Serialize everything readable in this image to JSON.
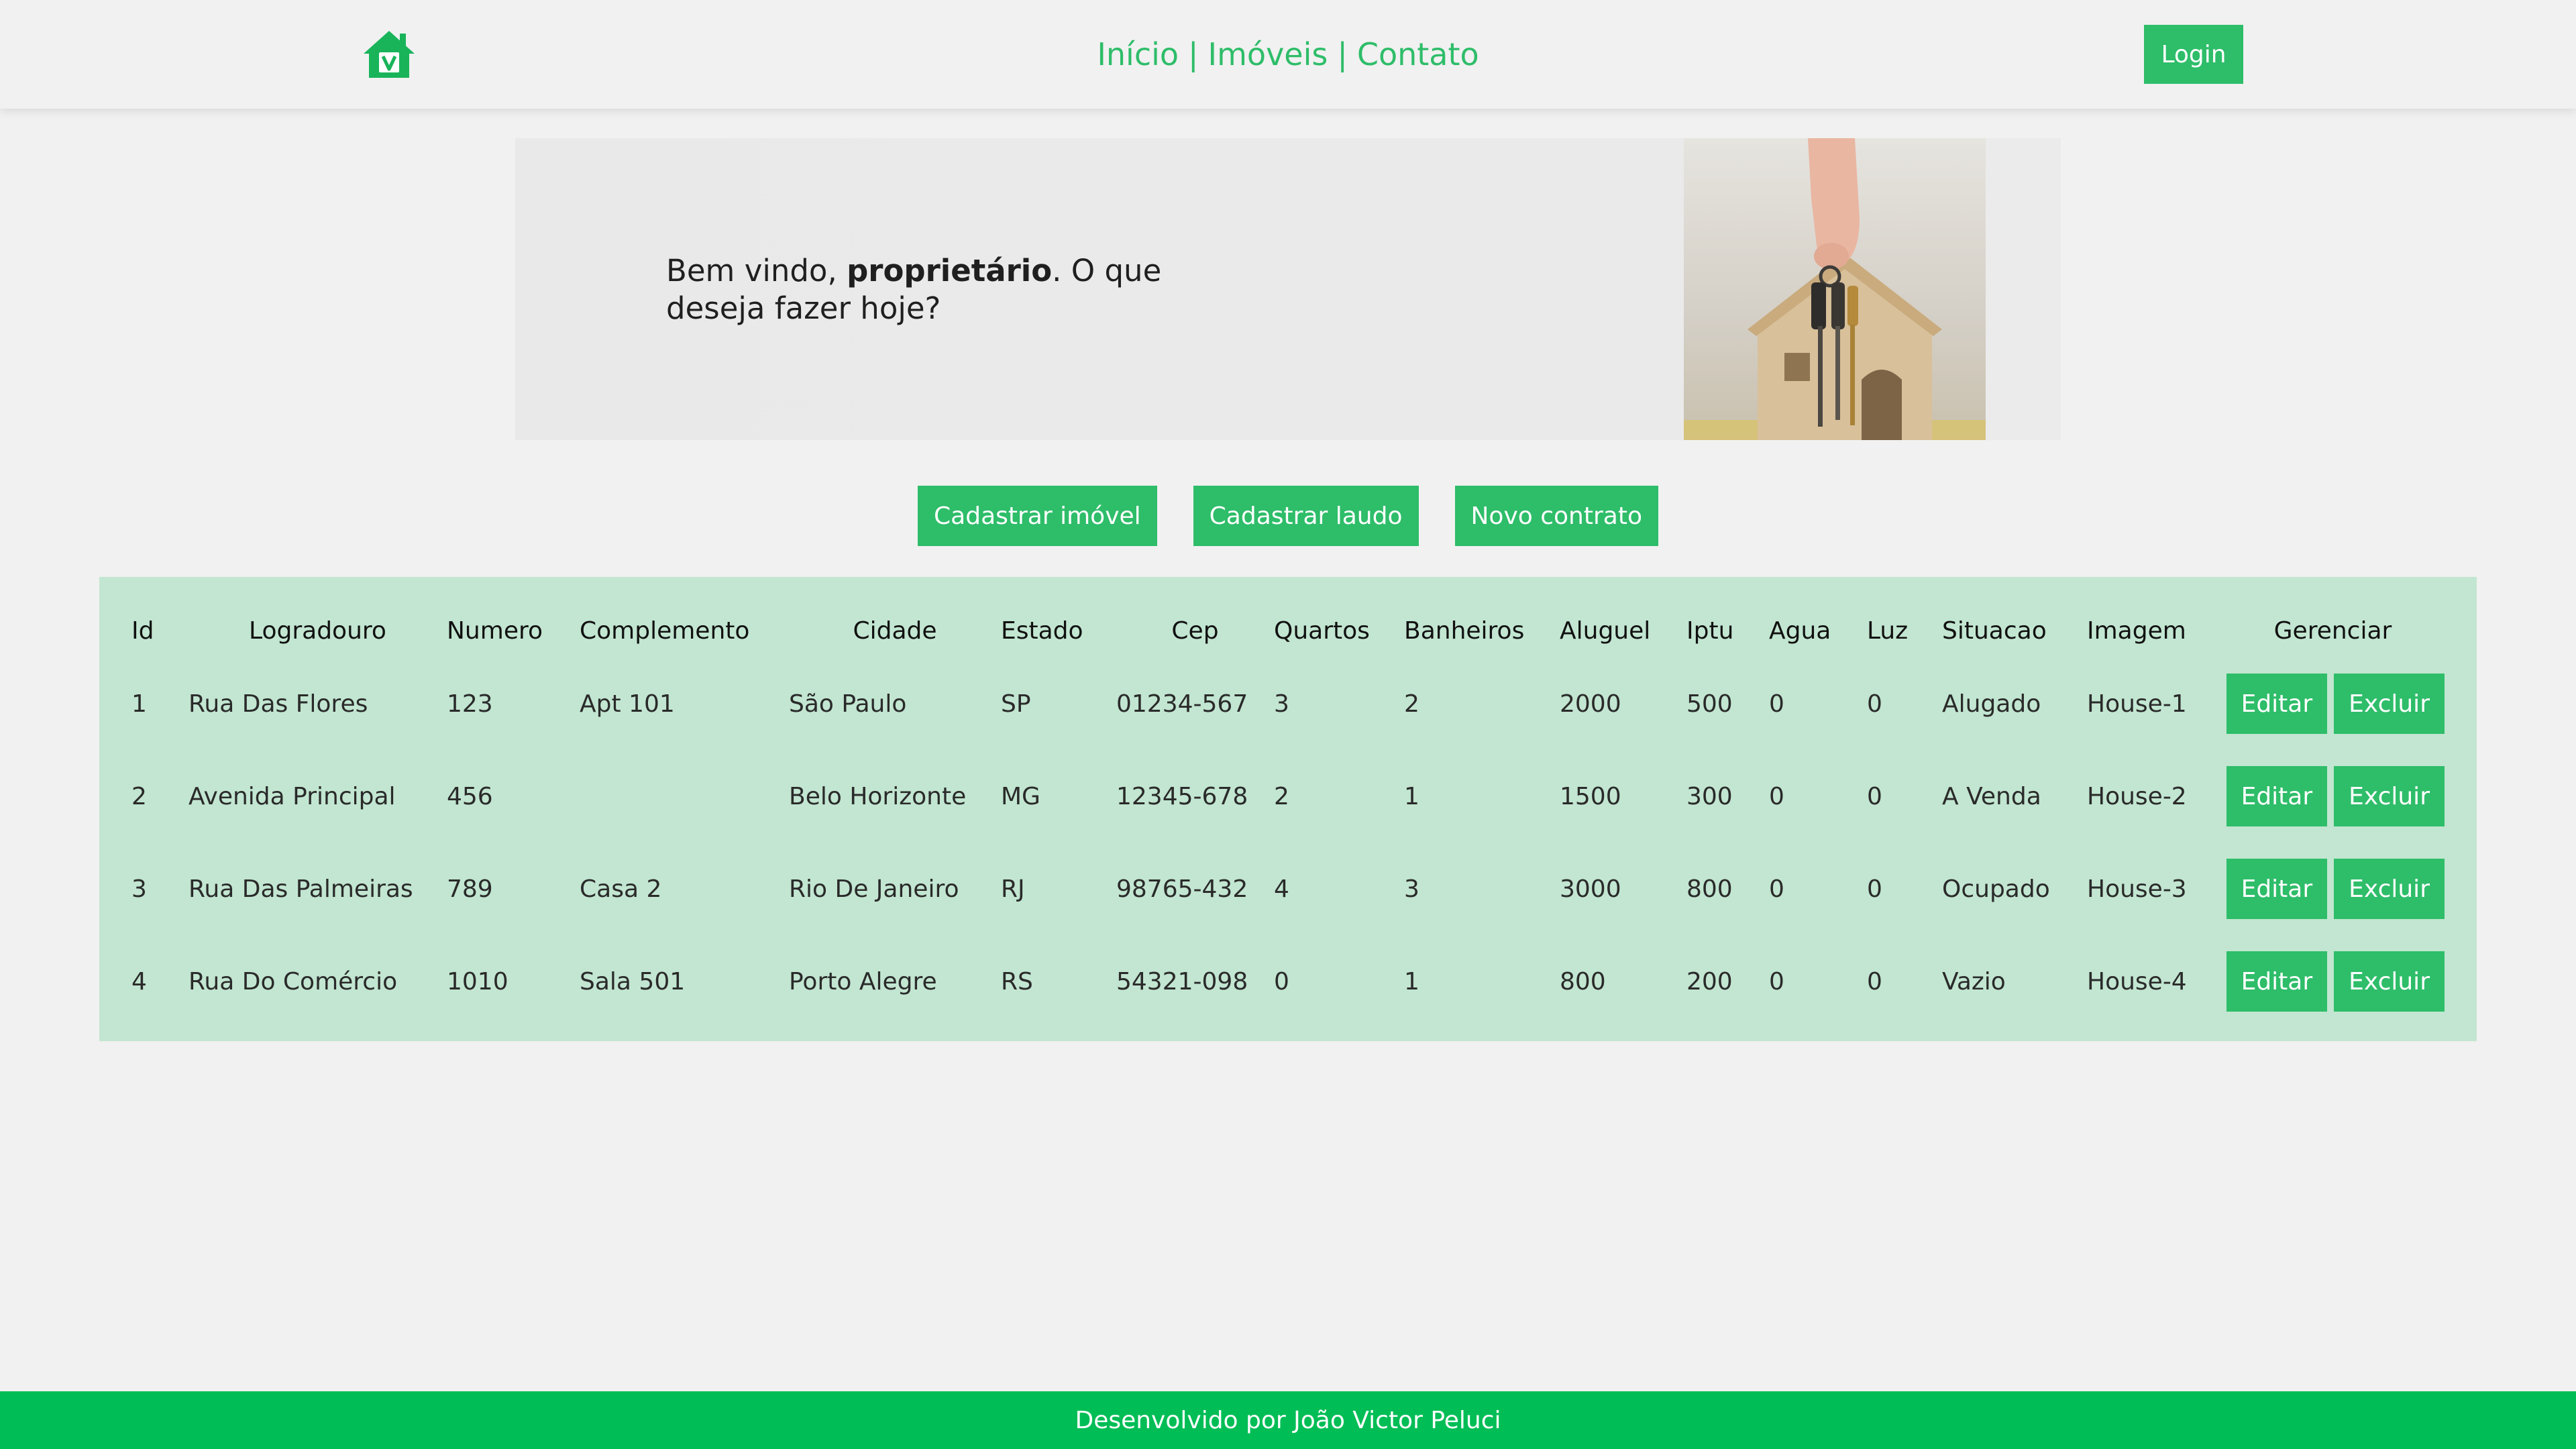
{
  "header": {
    "logo_icon": "house-icon",
    "nav": {
      "inicio": "Início",
      "imoveis": "Imóveis",
      "contato": "Contato",
      "separator": "|"
    },
    "login_label": "Login",
    "accent_color": "#2ebd69"
  },
  "banner": {
    "welcome_prefix": "Bem vindo, ",
    "welcome_role": "proprietário",
    "welcome_suffix": ". O que deseja fazer hoje?",
    "image_icon": "house-with-keys-photo"
  },
  "actions": {
    "cadastrar_imovel": "Cadastrar imóvel",
    "cadastrar_laudo": "Cadastrar laudo",
    "novo_contrato": "Novo contrato"
  },
  "table": {
    "headers": [
      "Id",
      "Logradouro",
      "Numero",
      "Complemento",
      "Cidade",
      "Estado",
      "Cep",
      "Quartos",
      "Banheiros",
      "Aluguel",
      "Iptu",
      "Agua",
      "Luz",
      "Situacao",
      "Imagem",
      "Gerenciar"
    ],
    "edit_label": "Editar",
    "delete_label": "Excluir",
    "rows": [
      [
        "1",
        "Rua Das Flores",
        "123",
        "Apt 101",
        "São Paulo",
        "SP",
        "01234-567",
        "3",
        "2",
        "2000",
        "500",
        "0",
        "0",
        "Alugado",
        "House-1"
      ],
      [
        "2",
        "Avenida Principal",
        "456",
        "",
        "Belo Horizonte",
        "MG",
        "12345-678",
        "2",
        "1",
        "1500",
        "300",
        "0",
        "0",
        "A Venda",
        "House-2"
      ],
      [
        "3",
        "Rua Das Palmeiras",
        "789",
        "Casa 2",
        "Rio De Janeiro",
        "RJ",
        "98765-432",
        "4",
        "3",
        "3000",
        "800",
        "0",
        "0",
        "Ocupado",
        "House-3"
      ],
      [
        "4",
        "Rua Do Comércio",
        "1010",
        "Sala 501",
        "Porto Alegre",
        "RS",
        "54321-098",
        "0",
        "1",
        "800",
        "200",
        "0",
        "0",
        "Vazio",
        "House-4"
      ]
    ]
  },
  "footer": {
    "text": "Desenvolvido por João Victor Peluci",
    "color": "#00bd55"
  }
}
